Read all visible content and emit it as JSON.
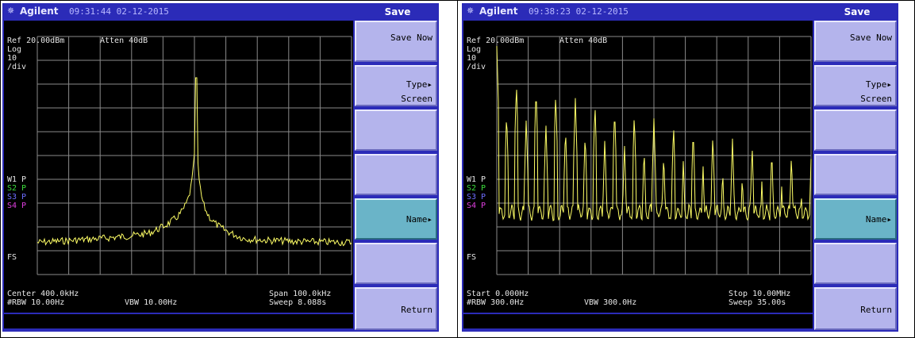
{
  "screens": [
    {
      "brand": "Agilent",
      "clock": "09:31:44 02-12-2015",
      "menu_title": "Save",
      "ref": "Ref 20.00dBm",
      "atten": "Atten 40dB",
      "scale_log": "Log",
      "scale_value": "10",
      "scale_unit": "/div",
      "trace_w1": "W1 P",
      "trace_s2": "S2 P",
      "trace_s3": "S3 P",
      "trace_s4": "S4 P",
      "fs": "FS",
      "left_bottom_1": "Center 400.0kHz",
      "left_bottom_2": "#RBW 10.00Hz",
      "mid_bottom_2": "VBW 10.00Hz",
      "right_bottom_1": "Span 100.0kHz",
      "right_bottom_2": "Sweep 8.088s",
      "softkeys": {
        "save_now": "Save Now",
        "type": "Type▸",
        "type_value": "Screen",
        "name": "Name▸",
        "return": "Return"
      },
      "trace_color": "#ffff66"
    },
    {
      "brand": "Agilent",
      "clock": "09:38:23 02-12-2015",
      "menu_title": "Save",
      "ref": "Ref 20.00dBm",
      "atten": "Atten 40dB",
      "scale_log": "Log",
      "scale_value": "10",
      "scale_unit": "/div",
      "trace_w1": "W1 P",
      "trace_s2": "S2 P",
      "trace_s3": "S3 P",
      "trace_s4": "S4 P",
      "fs": "FS",
      "left_bottom_1": "Start 0.000Hz",
      "left_bottom_2": "#RBW 300.0Hz",
      "mid_bottom_2": "VBW 300.0Hz",
      "right_bottom_1": "Stop 10.00MHz",
      "right_bottom_2": "Sweep 35.00s",
      "softkeys": {
        "save_now": "Save Now",
        "type": "Type▸",
        "type_value": "Screen",
        "name": "Name▸",
        "return": "Return"
      },
      "trace_color": "#ffff66"
    }
  ]
}
